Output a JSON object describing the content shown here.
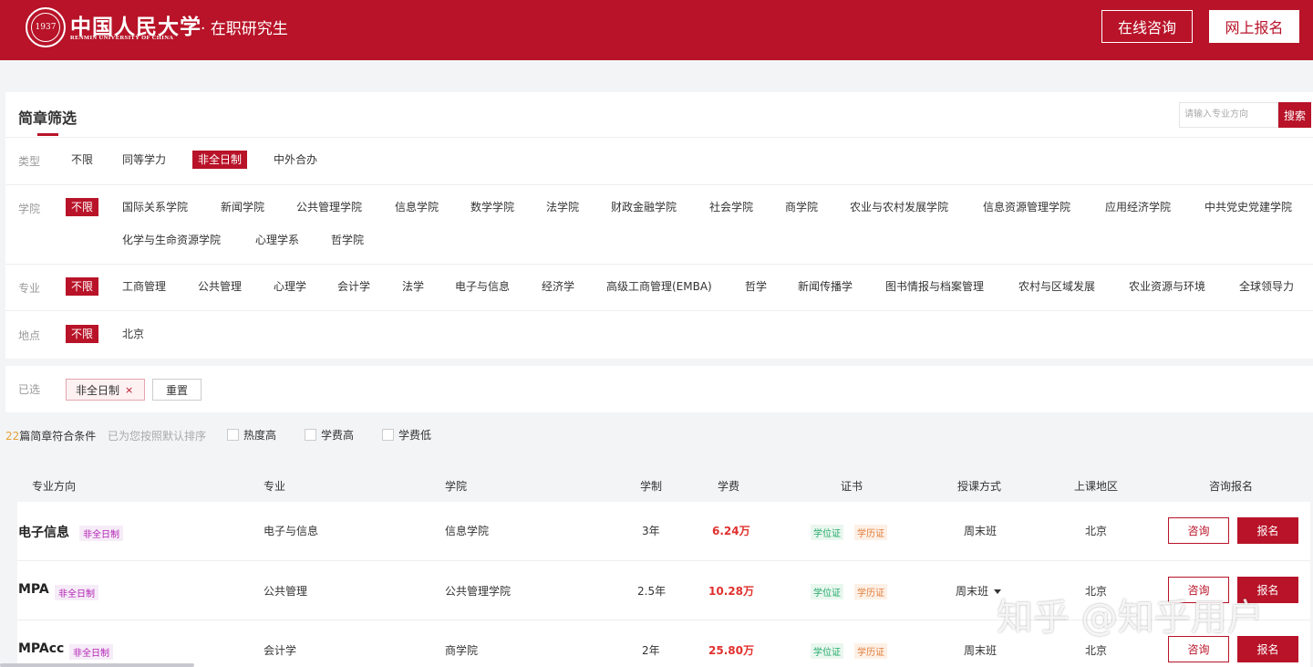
{
  "header": {
    "logo_cn": "中国人民大学",
    "logo_en": "RENMIN UNIVERSITY OF CHINA",
    "subtitle": "· 在职研究生",
    "consult_label": "在线咨询",
    "apply_label": "网上报名"
  },
  "filter": {
    "title": "简章筛选",
    "search_placeholder": "请输入专业方向",
    "search_button": "搜索",
    "type": {
      "label": "类型",
      "options": [
        "不限",
        "同等学力",
        "非全日制",
        "中外合办"
      ],
      "active": "非全日制"
    },
    "college": {
      "label": "学院",
      "options": [
        "不限",
        "国际关系学院",
        "新闻学院",
        "公共管理学院",
        "信息学院",
        "数学学院",
        "法学院",
        "财政金融学院",
        "社会学院",
        "商学院",
        "农业与农村发展学院",
        "信息资源管理学院",
        "应用经济学院",
        "中共党史党建学院",
        "化学与生命资源学院",
        "心理学系",
        "哲学院"
      ],
      "active": "不限"
    },
    "major": {
      "label": "专业",
      "options": [
        "不限",
        "工商管理",
        "公共管理",
        "心理学",
        "会计学",
        "法学",
        "电子与信息",
        "经济学",
        "高级工商管理(EMBA)",
        "哲学",
        "新闻传播学",
        "图书情报与档案管理",
        "农村与区域发展",
        "农业资源与环境",
        "全球领导力"
      ],
      "active": "不限"
    },
    "location": {
      "label": "地点",
      "options": [
        "不限",
        "北京"
      ],
      "active": "不限"
    }
  },
  "selected": {
    "label": "已选",
    "tags": [
      "非全日制"
    ],
    "remove_symbol": "×",
    "reset_label": "重置"
  },
  "results": {
    "count": "22",
    "count_suffix": "篇简章符合条件",
    "sort_hint": "已为您按照默认排序",
    "sort_options": [
      "热度高",
      "学费高",
      "学费低"
    ]
  },
  "table": {
    "headers": [
      "专业方向",
      "专业",
      "学院",
      "学制",
      "学费",
      "证书",
      "授课方式",
      "上课地区",
      "咨询报名"
    ],
    "consult_label": "咨询",
    "apply_label": "报名",
    "rows": [
      {
        "direction": "电子信息",
        "tag": "非全日制",
        "major": "电子与信息",
        "college": "信息学院",
        "duration": "3年",
        "fee": "6.24万",
        "certs": [
          "学位证",
          "学历证"
        ],
        "mode": "周末班",
        "region": "北京"
      },
      {
        "direction": "MPA",
        "tag": "非全日制",
        "major": "公共管理",
        "college": "公共管理学院",
        "duration": "2.5年",
        "fee": "10.28万",
        "certs": [
          "学位证",
          "学历证"
        ],
        "mode": "周末班",
        "region": "北京"
      },
      {
        "direction": "MPAcc",
        "tag": "非全日制",
        "major": "会计学",
        "college": "商学院",
        "duration": "2年",
        "fee": "25.80万",
        "certs": [
          "学位证",
          "学历证"
        ],
        "mode": "周末班",
        "region": "北京"
      }
    ]
  },
  "watermark": "知乎 @知乎用户"
}
